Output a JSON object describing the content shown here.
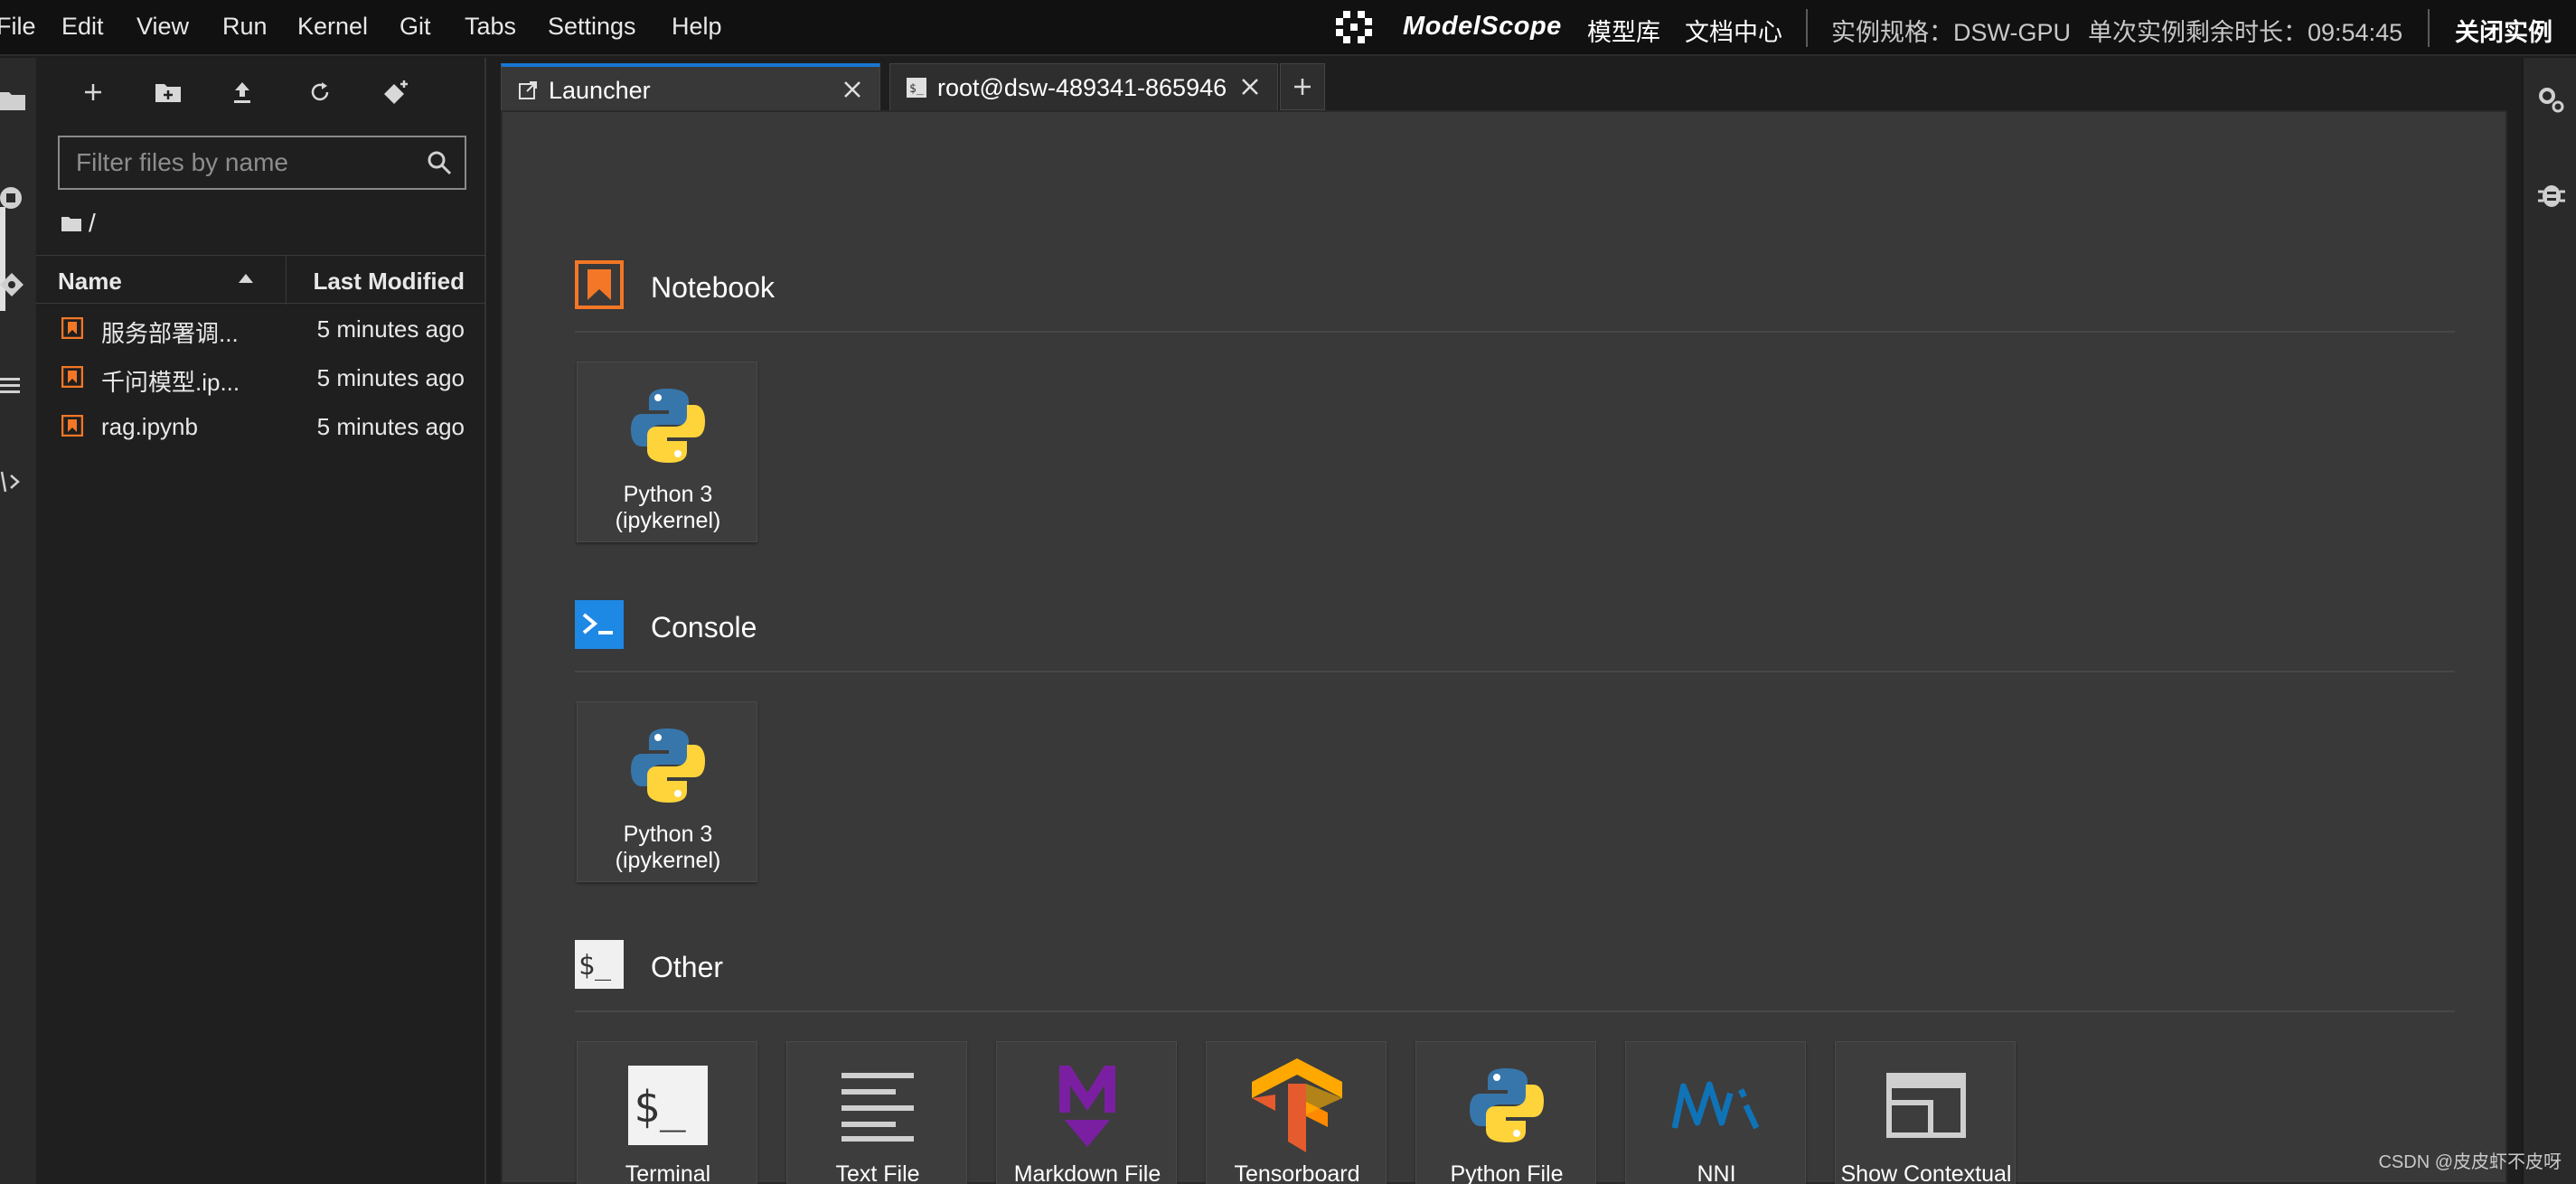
{
  "menubar": {
    "items": [
      "File",
      "Edit",
      "View",
      "Run",
      "Kernel",
      "Git",
      "Tabs",
      "Settings",
      "Help"
    ],
    "brand": "ModelScope",
    "links": [
      "模型库",
      "文档中心"
    ],
    "instance_spec": "实例规格：DSW-GPU",
    "remaining_time": "单次实例剩余时长：09:54:45",
    "close_instance": "关闭实例"
  },
  "filebrowser": {
    "search_placeholder": "Filter files by name",
    "breadcrumb": "/",
    "columns": {
      "name": "Name",
      "modified": "Last Modified"
    },
    "files": [
      {
        "name": "服务部署调...",
        "modified": "5 minutes ago"
      },
      {
        "name": "千问模型.ip...",
        "modified": "5 minutes ago"
      },
      {
        "name": "rag.ipynb",
        "modified": "5 minutes ago"
      }
    ]
  },
  "tabs": [
    {
      "label": "Launcher",
      "active": true
    },
    {
      "label": "root@dsw-489341-865946",
      "active": false
    }
  ],
  "launcher": {
    "sections": {
      "notebook": {
        "title": "Notebook",
        "cards": [
          "Python 3 (ipykernel)"
        ]
      },
      "console": {
        "title": "Console",
        "cards": [
          "Python 3 (ipykernel)"
        ]
      },
      "other": {
        "title": "Other",
        "cards": [
          "Terminal",
          "Text File",
          "Markdown File",
          "Tensorboard",
          "Python File",
          "NNI",
          "Show Contextual"
        ]
      }
    }
  },
  "colors": {
    "accent_blue": "#1976d2",
    "notebook_orange": "#f37726",
    "console_blue": "#1e88e5",
    "markdown_purple": "#7b1fa2",
    "nni_blue": "#0f73b8"
  },
  "watermark": "CSDN @皮皮虾不皮呀"
}
